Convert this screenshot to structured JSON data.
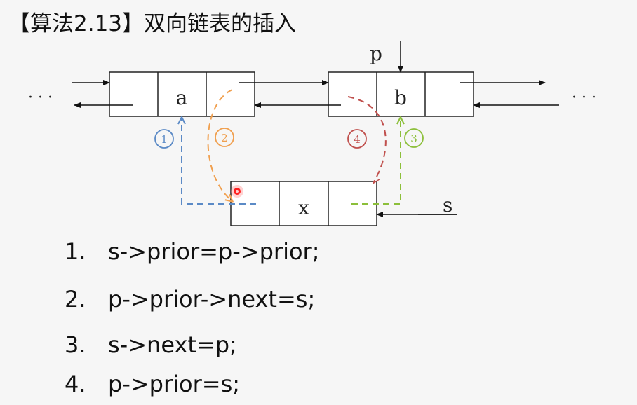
{
  "title": "【算法2.13】双向链表的插入",
  "diagram": {
    "ellipsis_left": "· · ·",
    "ellipsis_right": "· · ·",
    "node_a_label": "a",
    "node_b_label": "b",
    "node_x_label": "x",
    "pointer_p_label": "p",
    "pointer_s_label": "s",
    "step_markers": [
      "1",
      "2",
      "3",
      "4"
    ],
    "colors": {
      "step1": "#5b8ac6",
      "step2": "#f0a050",
      "step3": "#8cbf3a",
      "step4": "#c0504d"
    }
  },
  "steps": [
    {
      "num": "1.",
      "code": "s->prior=p->prior;"
    },
    {
      "num": "2.",
      "code": "p->prior->next=s;"
    },
    {
      "num": "3.",
      "code": "s->next=p;"
    },
    {
      "num": "4.",
      "code": "p->prior=s;"
    }
  ]
}
